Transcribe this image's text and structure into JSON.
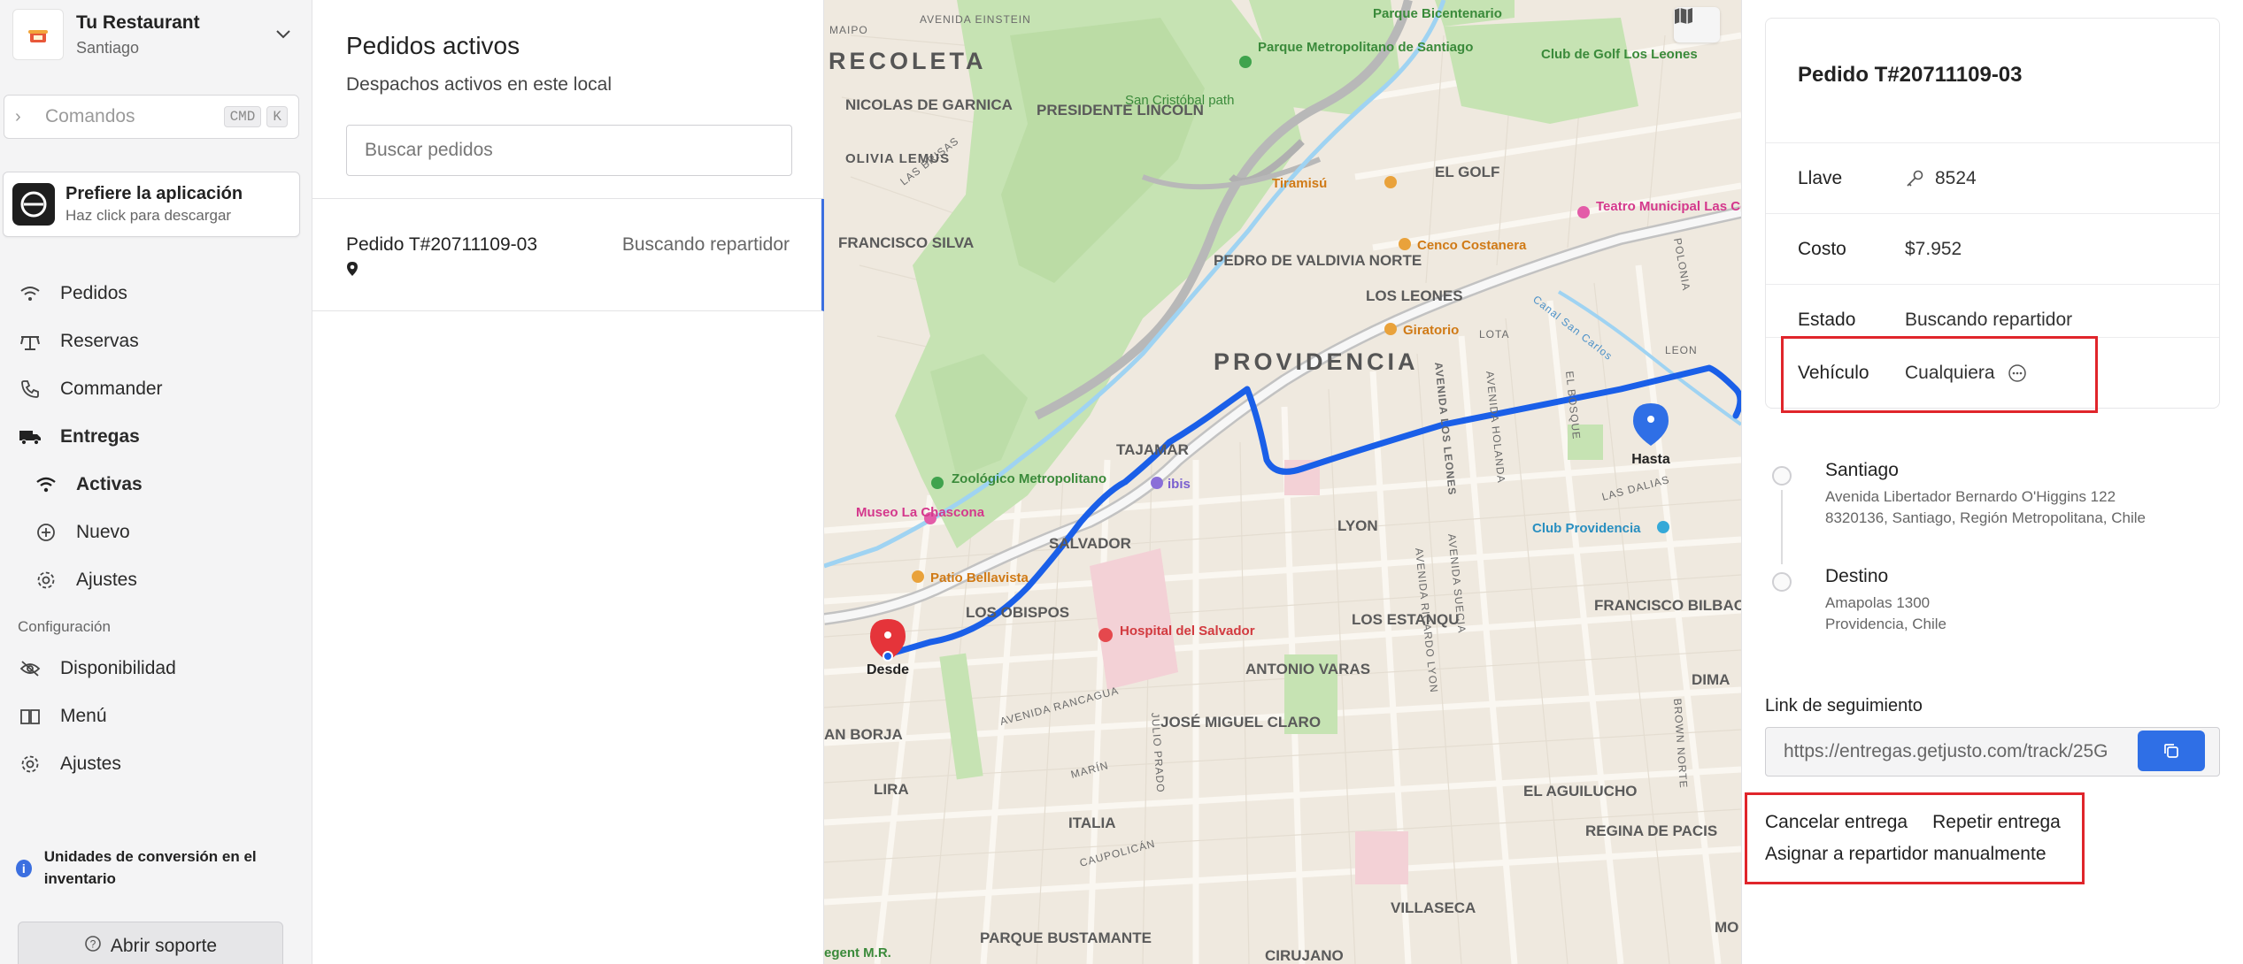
{
  "sidebar": {
    "restaurant_name": "Tu Restaurant",
    "restaurant_city": "Santiago",
    "command_placeholder": "Comandos",
    "command_kbd": [
      "CMD",
      "K"
    ],
    "app_promo_title": "Prefiere la aplicación",
    "app_promo_sub": "Haz click para descargar",
    "nav": [
      {
        "label": "Pedidos",
        "icon": "signal-icon"
      },
      {
        "label": "Reservas",
        "icon": "table-icon"
      },
      {
        "label": "Commander",
        "icon": "phone-icon"
      },
      {
        "label": "Entregas",
        "icon": "truck-icon"
      },
      {
        "label": "Activas",
        "icon": "wifi-icon"
      },
      {
        "label": "Nuevo",
        "icon": "plus-circle-icon"
      },
      {
        "label": "Ajustes",
        "icon": "gear-icon"
      }
    ],
    "config_section": "Configuración",
    "config_nav": [
      {
        "label": "Disponibilidad",
        "icon": "eye-off-icon"
      },
      {
        "label": "Menú",
        "icon": "book-icon"
      },
      {
        "label": "Ajustes",
        "icon": "gear-icon"
      }
    ],
    "notice": "Unidades de conversión en el inventario",
    "support_label": "Abrir soporte"
  },
  "orders": {
    "title": "Pedidos activos",
    "subtitle": "Despachos activos en este local",
    "search_placeholder": "Buscar pedidos",
    "items": [
      {
        "id": "Pedido T#20711109-03",
        "status": "Buscando repartidor"
      }
    ]
  },
  "map": {
    "labels": {
      "recoleta": "RECOLETA",
      "providencia": "PROVIDENCIA",
      "presidente_lincoln": "PRESIDENTE LINCOLN",
      "nicolas_garnica": "NICOLAS DE GARNICA",
      "francisco_silva": "FRANCISCO SILVA",
      "pedro_valdivia": "PEDRO DE VALDIVIA NORTE",
      "los_leones": "LOS LEONES",
      "el_golf": "EL GOLF",
      "lyon": "LYON",
      "tajamar": "TAJAMAR",
      "salvador": "SALVADOR",
      "los_obispos": "LOS OBISPOS",
      "los_estanqu": "LOS ESTANQU",
      "antonio_varas": "ANTONIO VARAS",
      "jose_miguel_claro": "JOSÉ MIGUEL CLARO",
      "francisco_bilbao": "FRANCISCO BILBAO",
      "el_aguilucho": "EL AGUILUCHO",
      "regina_pacis": "REGINA DE PACIS",
      "villaseca": "VILLASECA",
      "lira": "LIRA",
      "italia": "ITALIA",
      "an_borja": "AN BORJA",
      "cirujano": "CIRUJANO",
      "parque_bustamante": "PARQUE BUSTAMANTE",
      "dima": "DIMA",
      "mo": "MO",
      "lota": "LOTA",
      "leon": "LEON",
      "polonia": "POLONIA",
      "avenida_einstein": "AVENIDA EINSTEIN",
      "avenida_rancagua": "AVENIDA RANCAGUA",
      "avenida_los_leones": "AVENIDA LOS LEONES",
      "avenida_holanda": "AVENIDA HOLANDA",
      "el_bosque": "EL BOSQUE",
      "avenida_ricardo_lyon": "AVENIDA RICARDO LYON",
      "avenida_suecia": "AVENIDA SUECIA",
      "las_brisas": "LAS BRISAS",
      "las_dalias": "LAS DALIAS",
      "olivia_lemus": "OLIVIA LEMUS",
      "maipo": "MAIPO",
      "canal_san_carlos": "Canal San Carlos",
      "julio_prado": "JULIO PRADO",
      "marin": "MARÍN",
      "caupolican": "CAUPOLICÁN",
      "brown_norte": "BROWN NORTE",
      "parque_metropolitano": "Parque Metropolitano de Santiago",
      "san_cristobal": "San Cristóbal path",
      "parque_bicentenario": "Parque Bicentenario",
      "club_golf": "Club de Golf Los Leones",
      "tiramisu": "Tiramisú",
      "teatro": "Teatro Municipal Las Condes",
      "cenco": "Cenco Costanera",
      "giratorio": "Giratorio",
      "zoologico": "Zoológico Metropolitano",
      "museo": "Museo La Chascona",
      "patio": "Patio Bellavista",
      "hospital": "Hospital del Salvador",
      "club_providencia": "Club Providencia",
      "ibis": "ibis",
      "regent": "egent M.R.",
      "desde": "Desde",
      "hasta": "Hasta"
    }
  },
  "details": {
    "title": "Pedido T#20711109-03",
    "rows": [
      {
        "key": "Llave",
        "value": "8524"
      },
      {
        "key": "Costo",
        "value": "$7.952"
      },
      {
        "key": "Estado",
        "value": "Buscando repartidor"
      },
      {
        "key": "Vehículo",
        "value": "Cualquiera"
      }
    ],
    "stops": [
      {
        "name": "Santiago",
        "addr1": "Avenida Libertador Bernardo O'Higgins 122",
        "addr2": "8320136, Santiago, Región Metropolitana, Chile"
      },
      {
        "name": "Destino",
        "addr1": "Amapolas 1300",
        "addr2": "Providencia, Chile"
      }
    ],
    "tracking_label": "Link de seguimiento",
    "tracking_url": "https://entregas.getjusto.com/track/25G",
    "actions": {
      "cancel": "Cancelar entrega",
      "repeat": "Repetir entrega",
      "assign": "Asignar a repartidor manualmente"
    }
  },
  "colors": {
    "accent": "#2f6fe6",
    "highlight": "#e0252b",
    "route": "#1a5fe8",
    "park": "#c6e3b3"
  }
}
